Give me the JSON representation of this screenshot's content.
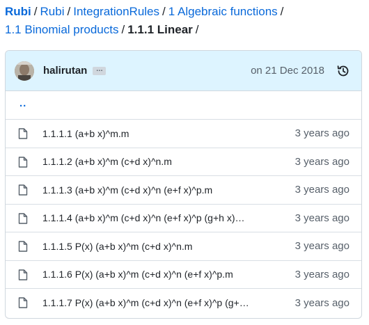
{
  "breadcrumb": {
    "items": [
      "Rubi",
      "Rubi",
      "IntegrationRules",
      "1 Algebraic functions",
      "1.1 Binomial products"
    ],
    "current": "1.1.1 Linear",
    "separator": "/"
  },
  "commit": {
    "author": "halirutan",
    "ellipsis": "…",
    "date": "on 21 Dec 2018"
  },
  "parent_link": "..",
  "files": [
    {
      "name": "1.1.1.1 (a+b x)^m.m",
      "age": "3 years ago"
    },
    {
      "name": "1.1.1.2 (a+b x)^m (c+d x)^n.m",
      "age": "3 years ago"
    },
    {
      "name": "1.1.1.3 (a+b x)^m (c+d x)^n (e+f x)^p.m",
      "age": "3 years ago"
    },
    {
      "name": "1.1.1.4 (a+b x)^m (c+d x)^n (e+f x)^p (g+h x)…",
      "age": "3 years ago"
    },
    {
      "name": "1.1.1.5 P(x) (a+b x)^m (c+d x)^n.m",
      "age": "3 years ago"
    },
    {
      "name": "1.1.1.6 P(x) (a+b x)^m (c+d x)^n (e+f x)^p.m",
      "age": "3 years ago"
    },
    {
      "name": "1.1.1.7 P(x) (a+b x)^m (c+d x)^n (e+f x)^p (g+…",
      "age": "3 years ago"
    }
  ],
  "colors": {
    "link": "#0969da",
    "commit_bar_bg": "#ddf4ff",
    "border": "#d0d7de",
    "muted_text": "#57606a"
  },
  "icons": {
    "file": "file-icon",
    "history": "history-icon",
    "avatar": "avatar"
  }
}
